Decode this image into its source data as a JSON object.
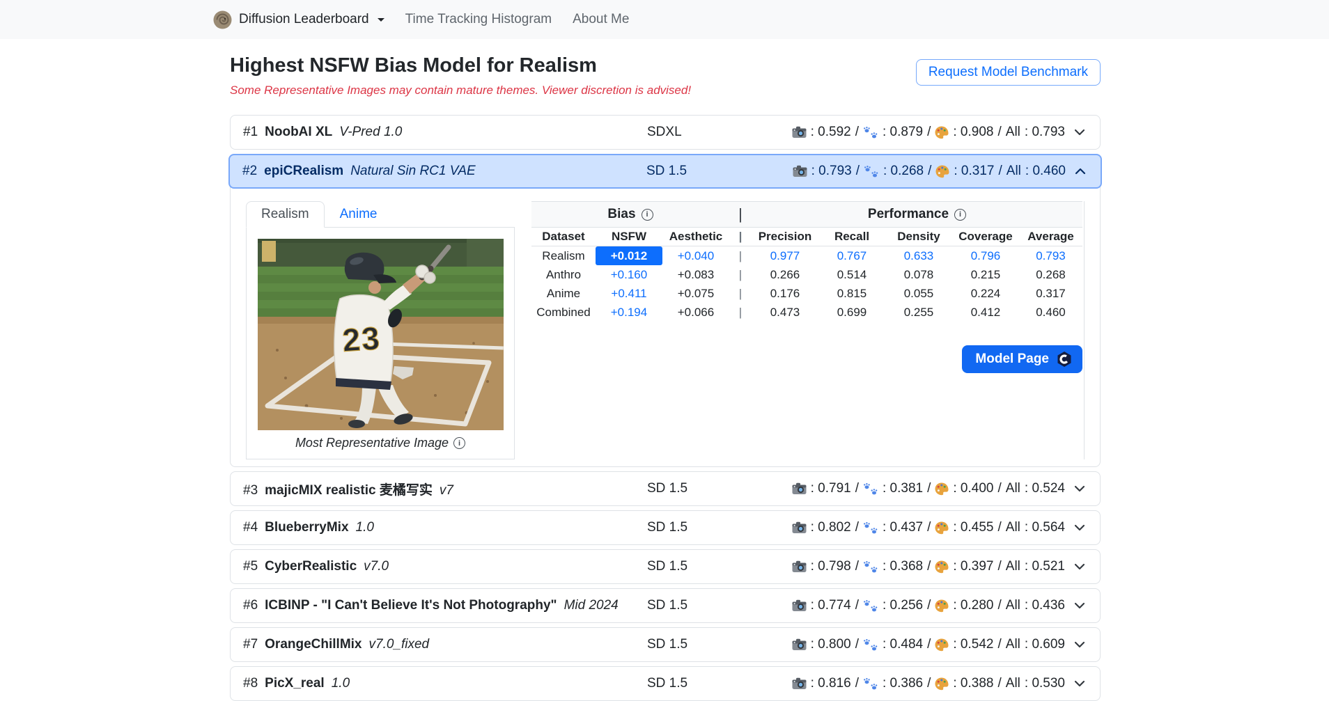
{
  "navbar": {
    "brand": "Diffusion Leaderboard",
    "links": [
      {
        "label": "Time Tracking Histogram"
      },
      {
        "label": "About Me"
      }
    ]
  },
  "header": {
    "title": "Highest NSFW Bias Model for Realism",
    "warning": "Some Representative Images may contain mature themes. Viewer discretion is advised!",
    "request_button": "Request Model Benchmark"
  },
  "format": {
    "colon": ":",
    "slash": "/"
  },
  "icons": {
    "info_glyph": "i",
    "stats_icons": [
      "camera-icon",
      "paw-prints-icon",
      "palette-icon"
    ]
  },
  "leaderboard": {
    "all_label": "All",
    "rows": [
      {
        "rank": "#1",
        "name": "NoobAI XL",
        "version": "V-Pred 1.0",
        "base": "SDXL",
        "camera": "0.592",
        "paw": "0.879",
        "palette": "0.908",
        "all": "0.793",
        "expanded": false
      },
      {
        "rank": "#2",
        "name": "epiCRealism",
        "version": "Natural Sin RC1 VAE",
        "base": "SD 1.5",
        "camera": "0.793",
        "paw": "0.268",
        "palette": "0.317",
        "all": "0.460",
        "expanded": true
      },
      {
        "rank": "#3",
        "name": "majicMIX realistic 麦橘写实",
        "version": "v7",
        "base": "SD 1.5",
        "camera": "0.791",
        "paw": "0.381",
        "palette": "0.400",
        "all": "0.524",
        "expanded": false
      },
      {
        "rank": "#4",
        "name": "BlueberryMix",
        "version": "1.0",
        "base": "SD 1.5",
        "camera": "0.802",
        "paw": "0.437",
        "palette": "0.455",
        "all": "0.564",
        "expanded": false
      },
      {
        "rank": "#5",
        "name": "CyberRealistic",
        "version": "v7.0",
        "base": "SD 1.5",
        "camera": "0.798",
        "paw": "0.368",
        "palette": "0.397",
        "all": "0.521",
        "expanded": false
      },
      {
        "rank": "#6",
        "name": "ICBINP - \"I Can't Believe It's Not Photography\"",
        "version": "Mid 2024",
        "base": "SD 1.5",
        "camera": "0.774",
        "paw": "0.256",
        "palette": "0.280",
        "all": "0.436",
        "expanded": false
      },
      {
        "rank": "#7",
        "name": "OrangeChillMix",
        "version": "v7.0_fixed",
        "base": "SD 1.5",
        "camera": "0.800",
        "paw": "0.484",
        "palette": "0.542",
        "all": "0.609",
        "expanded": false
      },
      {
        "rank": "#8",
        "name": "PicX_real",
        "version": "1.0",
        "base": "SD 1.5",
        "camera": "0.816",
        "paw": "0.386",
        "palette": "0.388",
        "all": "0.530",
        "expanded": false
      }
    ]
  },
  "detail": {
    "tabs": [
      {
        "label": "Realism",
        "active": true
      },
      {
        "label": "Anime",
        "active": false
      }
    ],
    "image_caption": "Most Representative Image",
    "jersey_number": "23",
    "model_page_button": "Model Page",
    "table": {
      "bias_label": "Bias",
      "performance_label": "Performance",
      "sep": "|",
      "columns": [
        "Dataset",
        "NSFW",
        "Aesthetic",
        "|",
        "Precision",
        "Recall",
        "Density",
        "Coverage",
        "Average"
      ],
      "rows": [
        {
          "dataset": "Realism",
          "nsfw": "+0.012",
          "aesthetic": "+0.040",
          "precision": "0.977",
          "recall": "0.767",
          "density": "0.633",
          "coverage": "0.796",
          "average": "0.793",
          "all_blue": true,
          "nsfw_selected": true
        },
        {
          "dataset": "Anthro",
          "nsfw": "+0.160",
          "aesthetic": "+0.083",
          "precision": "0.266",
          "recall": "0.514",
          "density": "0.078",
          "coverage": "0.215",
          "average": "0.268",
          "all_blue": false,
          "nsfw_selected": false
        },
        {
          "dataset": "Anime",
          "nsfw": "+0.411",
          "aesthetic": "+0.075",
          "precision": "0.176",
          "recall": "0.815",
          "density": "0.055",
          "coverage": "0.224",
          "average": "0.317",
          "all_blue": false,
          "nsfw_selected": false
        },
        {
          "dataset": "Combined",
          "nsfw": "+0.194",
          "aesthetic": "+0.066",
          "precision": "0.473",
          "recall": "0.699",
          "density": "0.255",
          "coverage": "0.412",
          "average": "0.460",
          "all_blue": false,
          "nsfw_selected": false
        }
      ]
    }
  },
  "colors": {
    "accent": "#0d6efd",
    "selected_row_bg": "#cfe2ff",
    "selected_row_border": "#79a8f9",
    "warning_red": "#dc3545",
    "card_border": "#dee2e6",
    "table_group_bg": "#f8f9fa",
    "model_page_bg": "#1168f2",
    "highlight_cell_bg": "#0d6efd"
  }
}
